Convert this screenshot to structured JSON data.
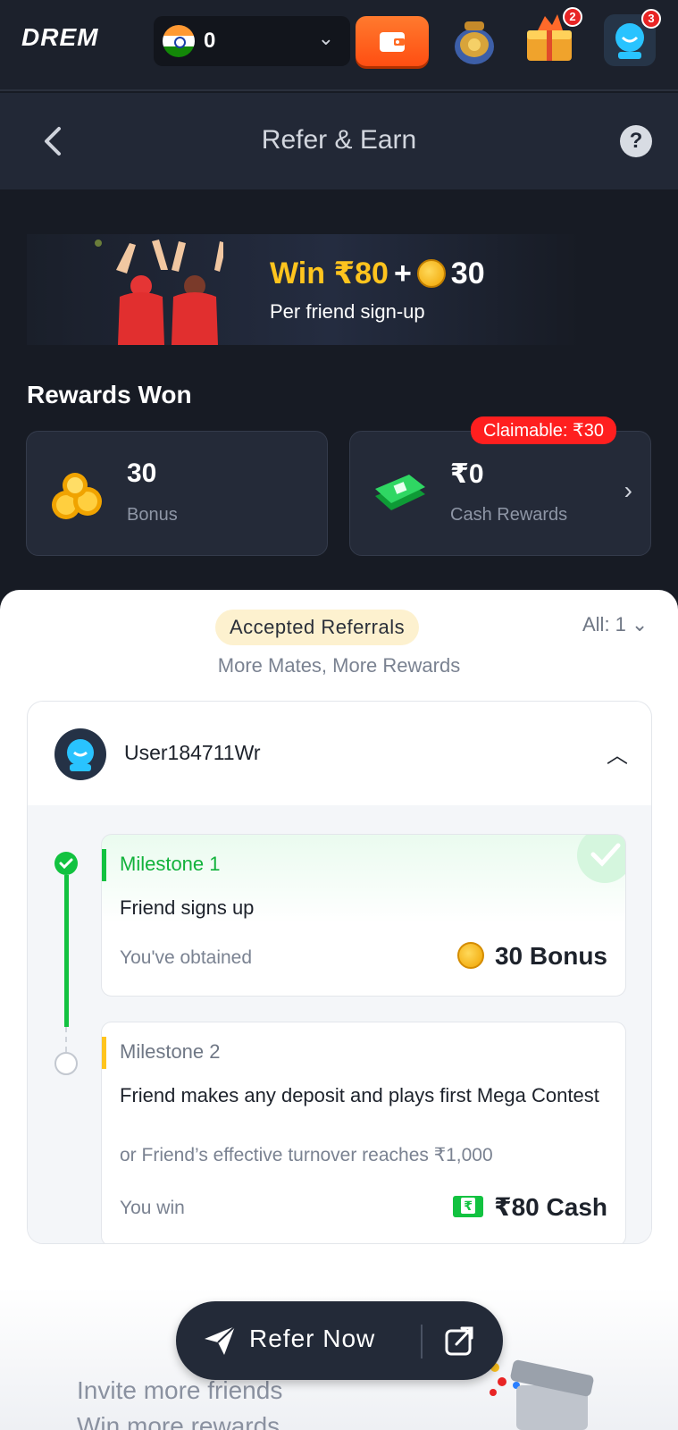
{
  "topbar": {
    "logo": "DREM",
    "balance": "0",
    "badges": {
      "chest": "2",
      "avatar": "3"
    }
  },
  "header": {
    "title": "Refer & Earn"
  },
  "banner": {
    "win_amount": "Win ₹80",
    "plus": "+",
    "coins": "30",
    "subtitle": "Per friend sign-up"
  },
  "rewards": {
    "title": "Rewards Won",
    "bonus": {
      "value": "30",
      "label": "Bonus"
    },
    "cash": {
      "value": "₹0",
      "label": "Cash Rewards",
      "claimable": "Claimable: ₹30"
    }
  },
  "referrals": {
    "tab_label": "Accepted Referrals",
    "filter_label": "All: 1",
    "subtitle": "More Mates, More Rewards",
    "user": {
      "name": "User184711Wr",
      "milestones": [
        {
          "title": "Milestone 1",
          "task": "Friend signs up",
          "reward_label": "You've obtained",
          "reward": "30 Bonus",
          "done": true
        },
        {
          "title": "Milestone 2",
          "task": "Friend makes any deposit and plays first Mega Contest",
          "alt": "or Friend’s effective turnover reaches ₹1,000",
          "reward_label": "You win",
          "reward": "₹80 Cash",
          "done": false
        }
      ]
    }
  },
  "cta": {
    "refer_label": "Refer Now",
    "invite_line1": "Invite more friends",
    "invite_line2": "Win more rewards"
  },
  "colors": {
    "accent_yellow": "#ffc41e",
    "success_green": "#12c240",
    "claim_red": "#ff1f1f",
    "wallet_orange": "#ff5a1a"
  }
}
